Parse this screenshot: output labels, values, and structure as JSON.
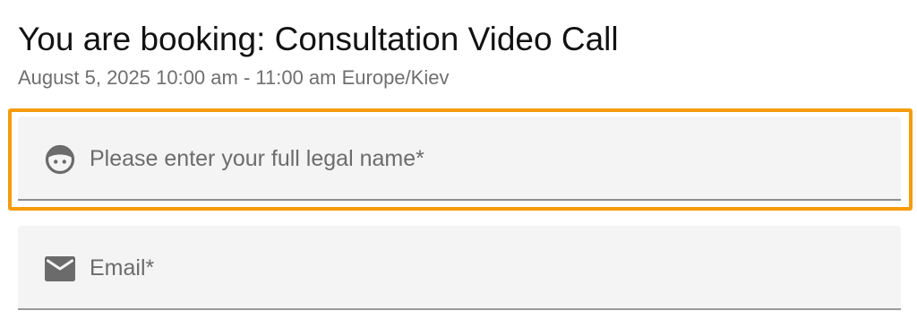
{
  "header": {
    "title": "You are booking: Consultation Video Call",
    "subtitle": "August 5, 2025 10:00 am - 11:00 am Europe/Kiev"
  },
  "form": {
    "name_field": {
      "placeholder": "Please enter your full legal name*",
      "value": "",
      "icon": "face-icon"
    },
    "email_field": {
      "placeholder": "Email*",
      "value": "",
      "icon": "mail-icon"
    }
  },
  "colors": {
    "focus_ring": "#f59b0c",
    "field_background": "#f4f4f4",
    "icon": "#6b6b6b"
  }
}
